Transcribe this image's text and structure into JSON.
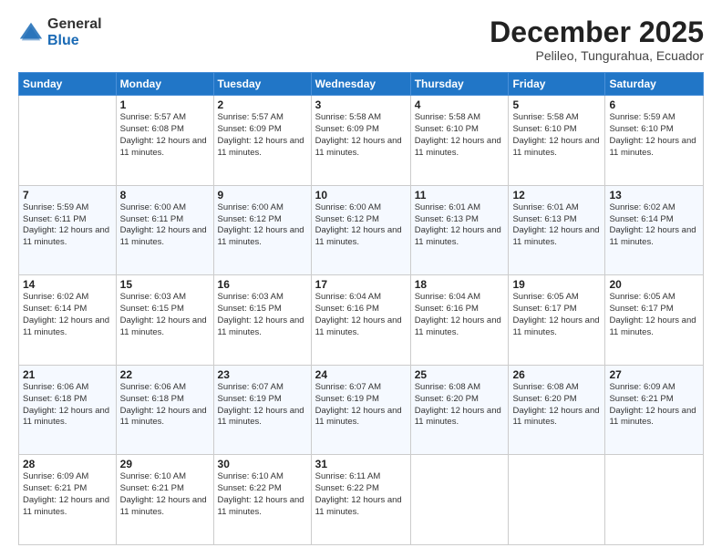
{
  "logo": {
    "general": "General",
    "blue": "Blue"
  },
  "title": "December 2025",
  "subtitle": "Pelileo, Tungurahua, Ecuador",
  "days_header": [
    "Sunday",
    "Monday",
    "Tuesday",
    "Wednesday",
    "Thursday",
    "Friday",
    "Saturday"
  ],
  "weeks": [
    [
      {
        "day": "",
        "info": ""
      },
      {
        "day": "1",
        "info": "Sunrise: 5:57 AM\nSunset: 6:08 PM\nDaylight: 12 hours and 11 minutes."
      },
      {
        "day": "2",
        "info": "Sunrise: 5:57 AM\nSunset: 6:09 PM\nDaylight: 12 hours and 11 minutes."
      },
      {
        "day": "3",
        "info": "Sunrise: 5:58 AM\nSunset: 6:09 PM\nDaylight: 12 hours and 11 minutes."
      },
      {
        "day": "4",
        "info": "Sunrise: 5:58 AM\nSunset: 6:10 PM\nDaylight: 12 hours and 11 minutes."
      },
      {
        "day": "5",
        "info": "Sunrise: 5:58 AM\nSunset: 6:10 PM\nDaylight: 12 hours and 11 minutes."
      },
      {
        "day": "6",
        "info": "Sunrise: 5:59 AM\nSunset: 6:10 PM\nDaylight: 12 hours and 11 minutes."
      }
    ],
    [
      {
        "day": "7",
        "info": "Sunrise: 5:59 AM\nSunset: 6:11 PM\nDaylight: 12 hours and 11 minutes."
      },
      {
        "day": "8",
        "info": "Sunrise: 6:00 AM\nSunset: 6:11 PM\nDaylight: 12 hours and 11 minutes."
      },
      {
        "day": "9",
        "info": "Sunrise: 6:00 AM\nSunset: 6:12 PM\nDaylight: 12 hours and 11 minutes."
      },
      {
        "day": "10",
        "info": "Sunrise: 6:00 AM\nSunset: 6:12 PM\nDaylight: 12 hours and 11 minutes."
      },
      {
        "day": "11",
        "info": "Sunrise: 6:01 AM\nSunset: 6:13 PM\nDaylight: 12 hours and 11 minutes."
      },
      {
        "day": "12",
        "info": "Sunrise: 6:01 AM\nSunset: 6:13 PM\nDaylight: 12 hours and 11 minutes."
      },
      {
        "day": "13",
        "info": "Sunrise: 6:02 AM\nSunset: 6:14 PM\nDaylight: 12 hours and 11 minutes."
      }
    ],
    [
      {
        "day": "14",
        "info": "Sunrise: 6:02 AM\nSunset: 6:14 PM\nDaylight: 12 hours and 11 minutes."
      },
      {
        "day": "15",
        "info": "Sunrise: 6:03 AM\nSunset: 6:15 PM\nDaylight: 12 hours and 11 minutes."
      },
      {
        "day": "16",
        "info": "Sunrise: 6:03 AM\nSunset: 6:15 PM\nDaylight: 12 hours and 11 minutes."
      },
      {
        "day": "17",
        "info": "Sunrise: 6:04 AM\nSunset: 6:16 PM\nDaylight: 12 hours and 11 minutes."
      },
      {
        "day": "18",
        "info": "Sunrise: 6:04 AM\nSunset: 6:16 PM\nDaylight: 12 hours and 11 minutes."
      },
      {
        "day": "19",
        "info": "Sunrise: 6:05 AM\nSunset: 6:17 PM\nDaylight: 12 hours and 11 minutes."
      },
      {
        "day": "20",
        "info": "Sunrise: 6:05 AM\nSunset: 6:17 PM\nDaylight: 12 hours and 11 minutes."
      }
    ],
    [
      {
        "day": "21",
        "info": "Sunrise: 6:06 AM\nSunset: 6:18 PM\nDaylight: 12 hours and 11 minutes."
      },
      {
        "day": "22",
        "info": "Sunrise: 6:06 AM\nSunset: 6:18 PM\nDaylight: 12 hours and 11 minutes."
      },
      {
        "day": "23",
        "info": "Sunrise: 6:07 AM\nSunset: 6:19 PM\nDaylight: 12 hours and 11 minutes."
      },
      {
        "day": "24",
        "info": "Sunrise: 6:07 AM\nSunset: 6:19 PM\nDaylight: 12 hours and 11 minutes."
      },
      {
        "day": "25",
        "info": "Sunrise: 6:08 AM\nSunset: 6:20 PM\nDaylight: 12 hours and 11 minutes."
      },
      {
        "day": "26",
        "info": "Sunrise: 6:08 AM\nSunset: 6:20 PM\nDaylight: 12 hours and 11 minutes."
      },
      {
        "day": "27",
        "info": "Sunrise: 6:09 AM\nSunset: 6:21 PM\nDaylight: 12 hours and 11 minutes."
      }
    ],
    [
      {
        "day": "28",
        "info": "Sunrise: 6:09 AM\nSunset: 6:21 PM\nDaylight: 12 hours and 11 minutes."
      },
      {
        "day": "29",
        "info": "Sunrise: 6:10 AM\nSunset: 6:21 PM\nDaylight: 12 hours and 11 minutes."
      },
      {
        "day": "30",
        "info": "Sunrise: 6:10 AM\nSunset: 6:22 PM\nDaylight: 12 hours and 11 minutes."
      },
      {
        "day": "31",
        "info": "Sunrise: 6:11 AM\nSunset: 6:22 PM\nDaylight: 12 hours and 11 minutes."
      },
      {
        "day": "",
        "info": ""
      },
      {
        "day": "",
        "info": ""
      },
      {
        "day": "",
        "info": ""
      }
    ]
  ]
}
